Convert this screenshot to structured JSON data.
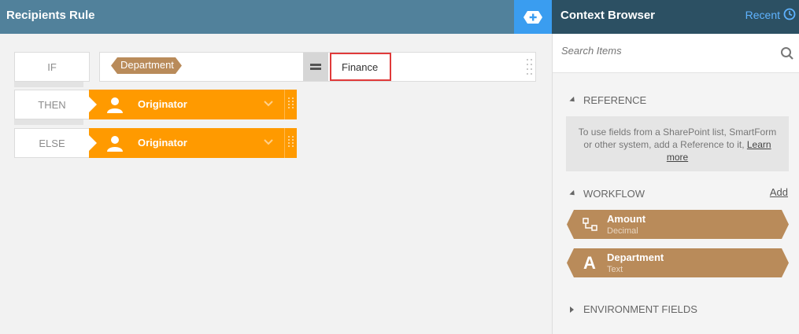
{
  "left": {
    "title": "Recipients Rule",
    "labels": {
      "if": "IF",
      "then": "THEN",
      "else": "ELSE"
    },
    "condition": {
      "token": "Department",
      "operator": "equals",
      "value": "Finance"
    },
    "then_value": "Originator",
    "else_value": "Originator"
  },
  "right": {
    "title": "Context Browser",
    "recent": "Recent",
    "search_placeholder": "Search Items",
    "reference": {
      "heading": "REFERENCE",
      "text": "To use fields from a SharePoint list, SmartForm or other system, add a Reference to it,",
      "link": "Learn more"
    },
    "workflow": {
      "heading": "WORKFLOW",
      "add": "Add",
      "items": [
        {
          "name": "Amount",
          "type": "Decimal",
          "icon": "decimal-icon"
        },
        {
          "name": "Department",
          "type": "Text",
          "icon": "text-icon"
        }
      ]
    },
    "environment": {
      "heading": "ENVIRONMENT FIELDS"
    }
  },
  "colors": {
    "header_left": "#51819b",
    "header_right": "#2c5063",
    "accent_blue": "#3a9df0",
    "orange": "#ff9a00",
    "token_brown": "#b98b5a",
    "highlight_red": "#e03a3a"
  }
}
